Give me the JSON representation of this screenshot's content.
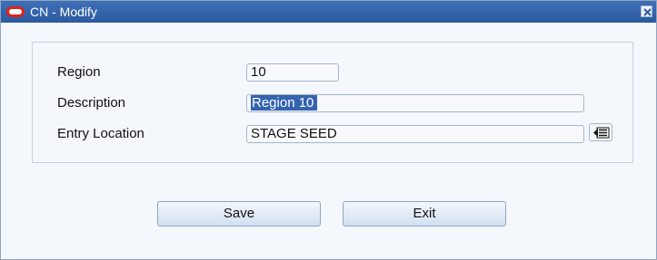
{
  "window": {
    "title": "CN - Modify"
  },
  "form": {
    "region_label": "Region",
    "region_value": "10",
    "description_label": "Description",
    "description_value": "Region 10",
    "entry_location_label": "Entry Location",
    "entry_location_value": "STAGE SEED"
  },
  "buttons": {
    "save_label": "Save",
    "exit_label": "Exit"
  },
  "icons": {
    "app_logo": "oracle-logo-icon",
    "close": "close-icon",
    "lov": "list-of-values-icon"
  }
}
